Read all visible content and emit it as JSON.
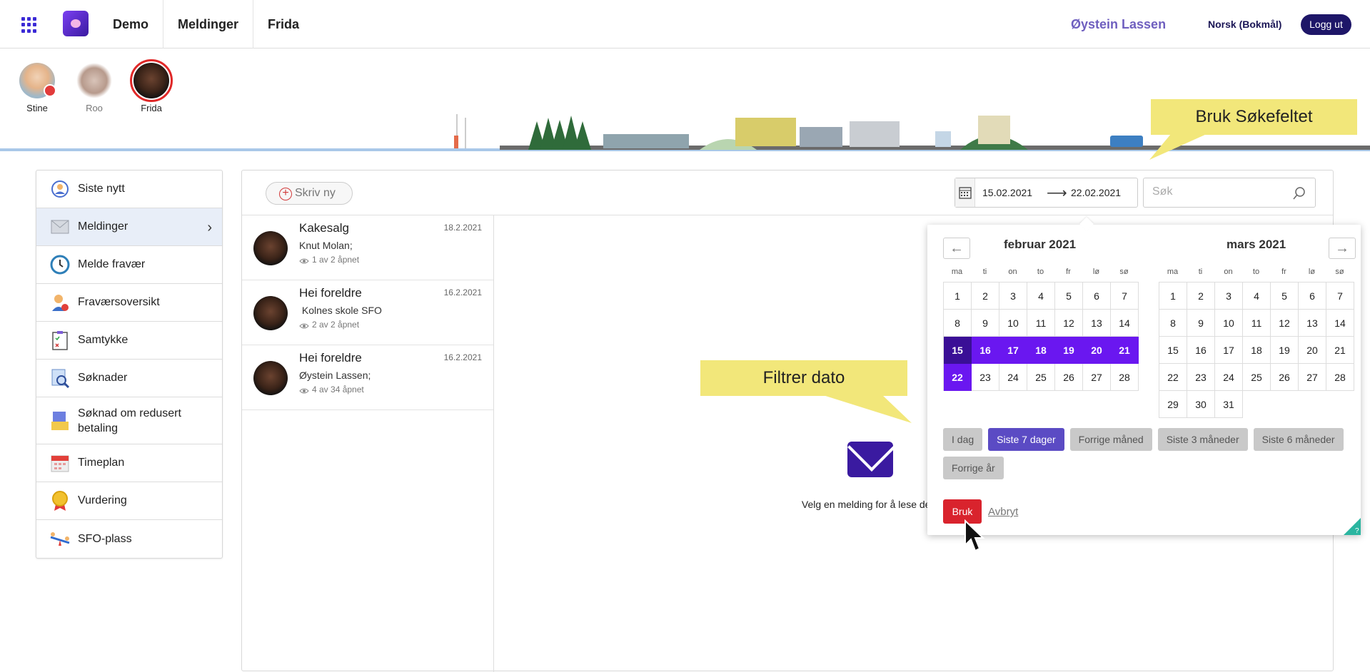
{
  "topbar": {
    "nav": [
      "Demo",
      "Meldinger",
      "Frida"
    ],
    "user": "Øystein Lassen",
    "language": "Norsk (Bokmål)",
    "logout": "Logg ut"
  },
  "children": [
    {
      "name": "Stine"
    },
    {
      "name": "Roo"
    },
    {
      "name": "Frida"
    }
  ],
  "sidebar": {
    "items": [
      {
        "label": "Siste nytt"
      },
      {
        "label": "Meldinger"
      },
      {
        "label": "Melde fravær"
      },
      {
        "label": "Fraværsoversikt"
      },
      {
        "label": "Samtykke"
      },
      {
        "label": "Søknader"
      },
      {
        "label": "Søknad om redusert betaling"
      },
      {
        "label": "Timeplan"
      },
      {
        "label": "Vurdering"
      },
      {
        "label": "SFO-plass"
      }
    ]
  },
  "toolbar": {
    "new_label": "Skriv ny",
    "date_from": "15.02.2021",
    "date_to": "22.02.2021",
    "search_placeholder": "Søk"
  },
  "messages": [
    {
      "title": "Kakesalg",
      "date": "18.2.2021",
      "from": "Knut Molan;",
      "read": "1 av 2 åpnet"
    },
    {
      "title": "Hei foreldre",
      "date": "16.2.2021",
      "from": " Kolnes skole SFO",
      "read": "2 av 2 åpnet"
    },
    {
      "title": "Hei foreldre",
      "date": "16.2.2021",
      "from": "Øystein Lassen;",
      "read": "4 av 34 åpnet"
    }
  ],
  "empty_state": "Velg en melding for å lese den.",
  "callouts": {
    "search": "Bruk Søkefeltet",
    "filter": "Filtrer dato"
  },
  "datepicker": {
    "weekdays": [
      "ma",
      "ti",
      "on",
      "to",
      "fr",
      "lø",
      "sø"
    ],
    "months": [
      {
        "title": "februar 2021",
        "days": [
          "1",
          "2",
          "3",
          "4",
          "5",
          "6",
          "7",
          "8",
          "9",
          "10",
          "11",
          "12",
          "13",
          "14",
          "15",
          "16",
          "17",
          "18",
          "19",
          "20",
          "21",
          "22",
          "23",
          "24",
          "25",
          "26",
          "27",
          "28"
        ],
        "range_start": "15",
        "range_end": "22"
      },
      {
        "title": "mars 2021",
        "days": [
          "1",
          "2",
          "3",
          "4",
          "5",
          "6",
          "7",
          "8",
          "9",
          "10",
          "11",
          "12",
          "13",
          "14",
          "15",
          "16",
          "17",
          "18",
          "19",
          "20",
          "21",
          "22",
          "23",
          "24",
          "25",
          "26",
          "27",
          "28",
          "29",
          "30",
          "31"
        ]
      }
    ],
    "presets": [
      "I dag",
      "Siste 7 dager",
      "Forrige måned",
      "Siste 3 måneder",
      "Siste 6 måneder",
      "Forrige år"
    ],
    "active_preset": "Siste 7 dager",
    "apply": "Bruk",
    "cancel": "Avbryt"
  },
  "colors": {
    "accent": "#6a17f0",
    "range_start": "#3a0f96",
    "navy": "#1e1668",
    "apply": "#d9232d",
    "callout": "#f2e77a"
  }
}
